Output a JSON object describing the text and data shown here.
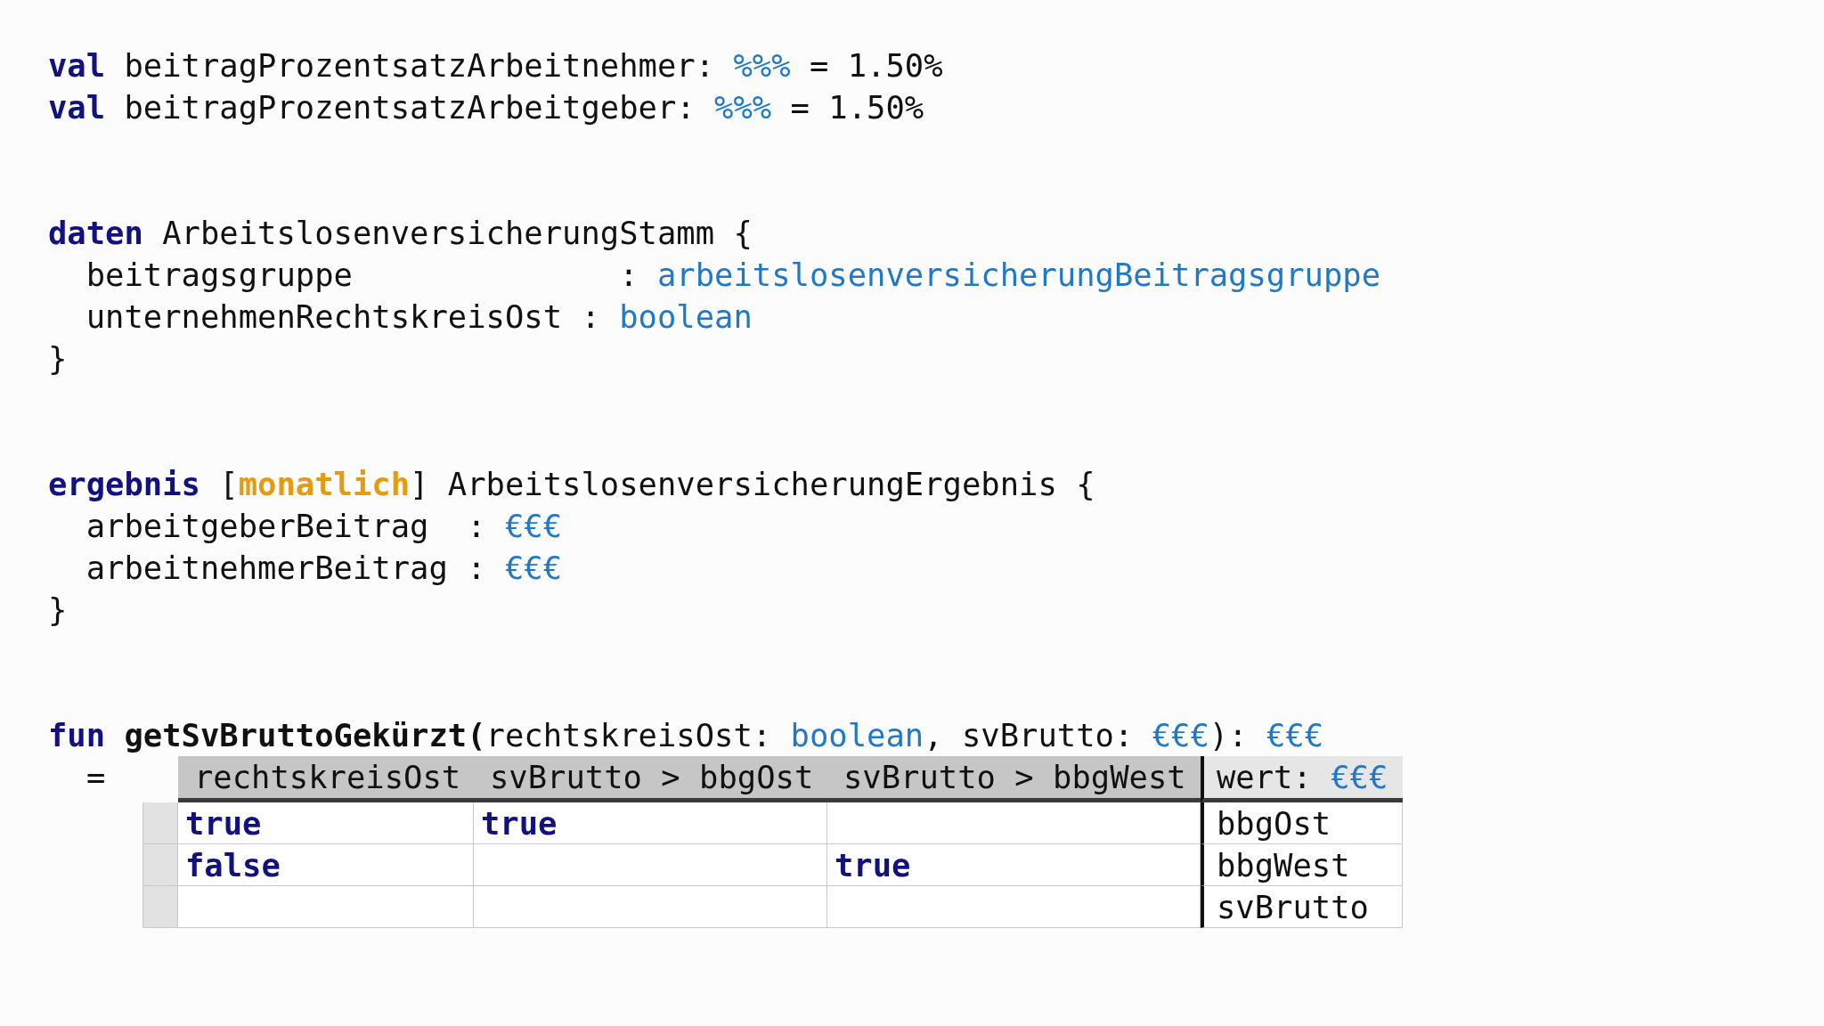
{
  "blocks": [
    {
      "lines": [
        [
          {
            "text": "val",
            "kind": "keyword"
          },
          {
            "text": " beitragProzentsatzArbeitnehmer: ",
            "kind": "plain"
          },
          {
            "text": "%%%",
            "kind": "type"
          },
          {
            "text": " = 1.50%",
            "kind": "plain"
          }
        ],
        [
          {
            "text": "val",
            "kind": "keyword"
          },
          {
            "text": " beitragProzentsatzArbeitgeber: ",
            "kind": "plain"
          },
          {
            "text": "%%%",
            "kind": "type"
          },
          {
            "text": " = 1.50%",
            "kind": "plain"
          }
        ]
      ]
    },
    {
      "lines": [
        [
          {
            "text": "daten",
            "kind": "keyword"
          },
          {
            "text": " ArbeitslosenversicherungStamm {",
            "kind": "plain"
          }
        ],
        [
          {
            "text": "  beitragsgruppe              : ",
            "kind": "plain"
          },
          {
            "text": "arbeitslosenversicherungBeitragsgruppe",
            "kind": "type"
          }
        ],
        [
          {
            "text": "  unternehmenRechtskreisOst : ",
            "kind": "plain"
          },
          {
            "text": "boolean",
            "kind": "type"
          }
        ],
        [
          {
            "text": "}",
            "kind": "plain"
          }
        ]
      ]
    },
    {
      "lines": [
        [
          {
            "text": "ergebnis",
            "kind": "keyword"
          },
          {
            "text": " [",
            "kind": "plain"
          },
          {
            "text": "monatlich",
            "kind": "annotation"
          },
          {
            "text": "] ArbeitslosenversicherungErgebnis {",
            "kind": "plain"
          }
        ],
        [
          {
            "text": "  arbeitgeberBeitrag  : ",
            "kind": "plain"
          },
          {
            "text": "€€€",
            "kind": "type"
          }
        ],
        [
          {
            "text": "  arbeitnehmerBeitrag : ",
            "kind": "plain"
          },
          {
            "text": "€€€",
            "kind": "type"
          }
        ],
        [
          {
            "text": "}",
            "kind": "plain"
          }
        ]
      ]
    },
    {
      "lines": [
        [
          {
            "text": "fun",
            "kind": "keyword"
          },
          {
            "text": " getSvBruttoGekürzt(",
            "kind": "name"
          },
          {
            "text": "rechtskreisOst: ",
            "kind": "plain"
          },
          {
            "text": "boolean",
            "kind": "type"
          },
          {
            "text": ", svBrutto: ",
            "kind": "plain"
          },
          {
            "text": "€€€",
            "kind": "type"
          },
          {
            "text": "): ",
            "kind": "plain"
          },
          {
            "text": "€€€",
            "kind": "type"
          }
        ]
      ]
    }
  ],
  "decision_table": {
    "equals": "=",
    "columns": [
      "rechtskreisOst",
      "svBrutto > bbgOst",
      "svBrutto > bbgWest"
    ],
    "result_header": [
      {
        "text": "wert: ",
        "kind": "plain"
      },
      {
        "text": "€€€",
        "kind": "type"
      }
    ],
    "rows": [
      {
        "cells": [
          {
            "text": "true",
            "kind": "keyword"
          },
          {
            "text": "true",
            "kind": "keyword"
          },
          null
        ],
        "result": "bbgOst"
      },
      {
        "cells": [
          {
            "text": "false",
            "kind": "keyword"
          },
          null,
          {
            "text": "true",
            "kind": "keyword"
          }
        ],
        "result": "bbgWest"
      },
      {
        "cells": [
          null,
          null,
          null
        ],
        "result": "svBrutto"
      }
    ]
  }
}
